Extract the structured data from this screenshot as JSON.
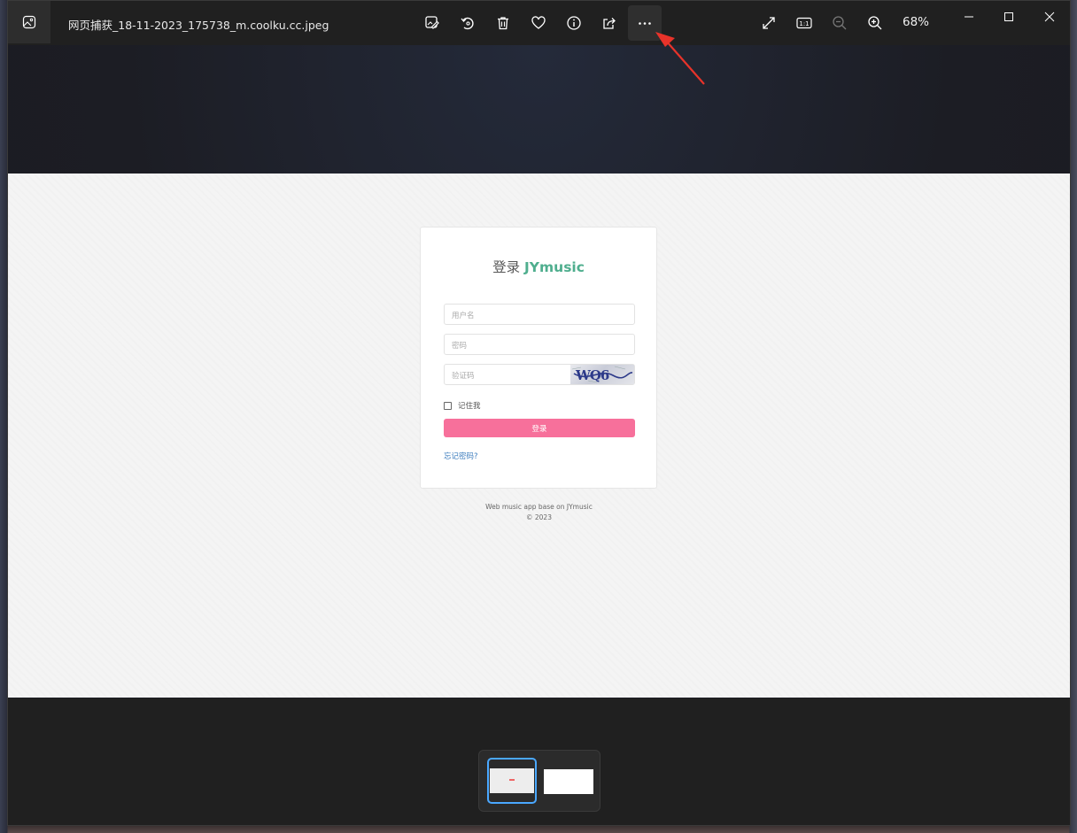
{
  "window": {
    "title": "网页捕获_18-11-2023_175738_m.coolku.cc.jpeg",
    "zoom_level": "68%"
  },
  "toolbar": {
    "icons": [
      "edit-image-icon",
      "rotate-icon",
      "delete-icon",
      "favorite-icon",
      "info-icon",
      "share-icon",
      "more-icon"
    ],
    "right_icons": [
      "fullscreen-icon",
      "actual-size-icon",
      "zoom-out-icon",
      "zoom-in-icon"
    ],
    "actual_size_label": "1:1"
  },
  "login_page": {
    "title_prefix": "登录",
    "brand": "JYmusic",
    "username_placeholder": "用户名",
    "password_placeholder": "密码",
    "captcha_placeholder": "验证码",
    "captcha_text": "WQ6",
    "remember_label": "记住我",
    "login_button": "登录",
    "forgot_link": "忘记密码?",
    "footer_line1": "Web music app base on JYmusic",
    "footer_line2": "© 2023"
  },
  "colors": {
    "brand": "#4fae8e",
    "login_button": "#f7709b",
    "link": "#3a7bbd",
    "thumbnail_selected": "#4aa8ff",
    "annotation_arrow": "#e8332a"
  }
}
